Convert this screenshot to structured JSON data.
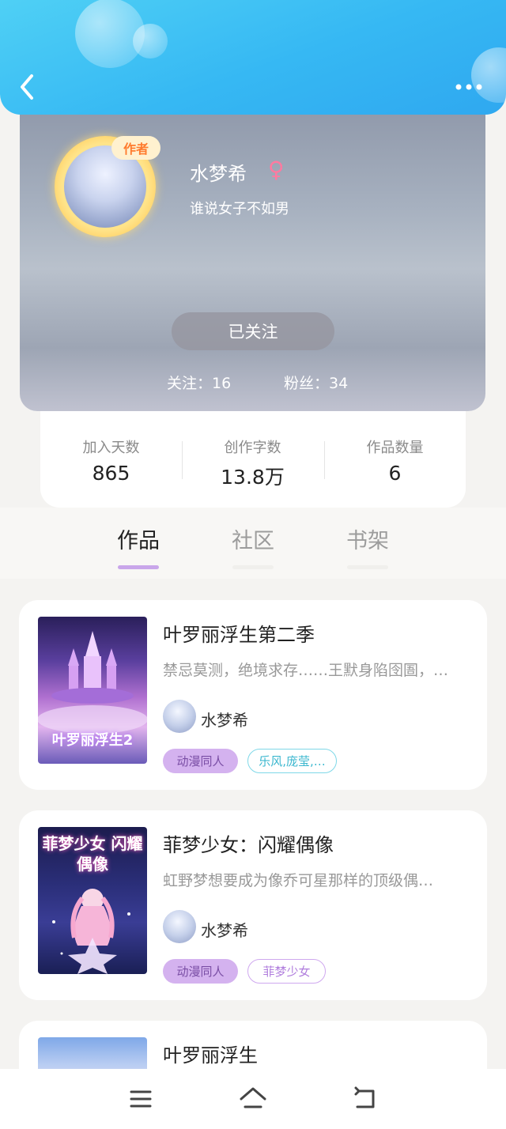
{
  "header": {
    "back_icon": "chevron-left-icon",
    "more_icon": "more-horizontal-icon"
  },
  "profile": {
    "author_badge": "作者",
    "name": "水梦希",
    "gender_symbol": "♀",
    "bio": "谁说女子不如男",
    "follow_button": "已关注",
    "following_label": "关注：16",
    "followers_label": "粉丝：34"
  },
  "stats": [
    {
      "label": "加入天数",
      "value": "865"
    },
    {
      "label": "创作字数",
      "value": "13.8万"
    },
    {
      "label": "作品数量",
      "value": "6"
    }
  ],
  "tabs": [
    {
      "label": "作品",
      "active": true
    },
    {
      "label": "社区",
      "active": false
    },
    {
      "label": "书架",
      "active": false
    }
  ],
  "books": [
    {
      "cover_text": "叶罗丽浮生2",
      "title": "叶罗丽浮生第二季",
      "description": "禁忌莫测，绝境求存……王默身陷囹圄，…",
      "author": "水梦希",
      "tags": [
        "动漫同人",
        "乐风,庞莹,…"
      ]
    },
    {
      "cover_text": "菲梦少女 闪耀偶像",
      "title": "菲梦少女：闪耀偶像",
      "description": "虹野梦想要成为像乔可星那样的顶级偶…",
      "author": "水梦希",
      "tags": [
        "动漫同人",
        "菲梦少女"
      ]
    },
    {
      "title": "叶罗丽浮生"
    }
  ],
  "bottom_nav": {
    "menu_icon": "menu-icon",
    "home_icon": "home-icon",
    "back_icon": "return-icon"
  },
  "colors": {
    "header_blue": "#36b8f3",
    "accent_purple": "#c9a6ea",
    "gender_pink": "#ff7aa0"
  }
}
